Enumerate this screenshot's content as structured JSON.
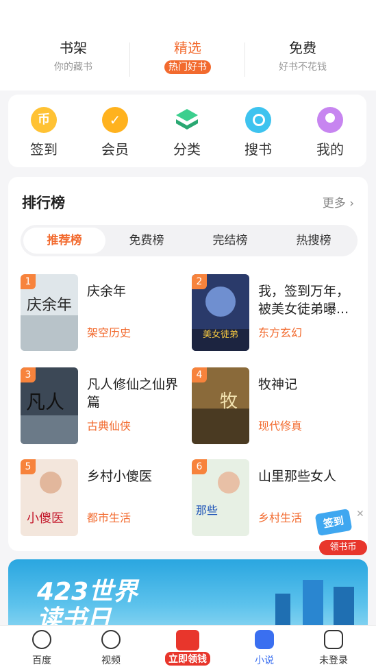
{
  "top_tabs": [
    {
      "title": "书架",
      "subtitle": "你的藏书"
    },
    {
      "title": "精选",
      "subtitle": "热门好书"
    },
    {
      "title": "免费",
      "subtitle": "好书不花钱"
    }
  ],
  "quick_nav": [
    {
      "label": "签到",
      "icon": "coin-icon"
    },
    {
      "label": "会员",
      "icon": "vip-icon"
    },
    {
      "label": "分类",
      "icon": "category-icon"
    },
    {
      "label": "搜书",
      "icon": "search-icon"
    },
    {
      "label": "我的",
      "icon": "profile-icon"
    }
  ],
  "ranking": {
    "title": "排行榜",
    "more": "更多",
    "tabs": [
      "推荐榜",
      "免费榜",
      "完结榜",
      "热搜榜"
    ],
    "books": [
      {
        "rank": "1",
        "name": "庆余年",
        "tag": "架空历史"
      },
      {
        "rank": "2",
        "name": "我，签到万年，被美女徒弟曝...",
        "tag": "东方玄幻"
      },
      {
        "rank": "3",
        "name": "凡人修仙之仙界篇",
        "tag": "古典仙侠"
      },
      {
        "rank": "4",
        "name": "牧神记",
        "tag": "现代修真"
      },
      {
        "rank": "5",
        "name": "乡村小傻医",
        "tag": "都市生活"
      },
      {
        "rank": "6",
        "name": "山里那些女人",
        "tag": "乡村生活"
      }
    ]
  },
  "float_coin": {
    "sign": "签到",
    "label": "领书币"
  },
  "banner": {
    "text_line1": "423世界",
    "text_line2": "读书日"
  },
  "bottom_nav": [
    {
      "label": "百度"
    },
    {
      "label": "视频"
    },
    {
      "label": "立即领钱"
    },
    {
      "label": "小说"
    },
    {
      "label": "未登录"
    }
  ],
  "colors": {
    "accent": "#f26a2e",
    "nav_active": "#3a6ff0",
    "rank_badge": "#f7833c"
  }
}
